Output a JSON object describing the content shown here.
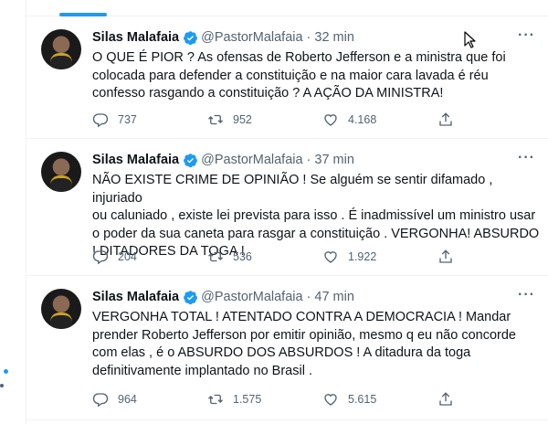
{
  "accent": "#1d9bf0",
  "tweets": [
    {
      "name": "Silas Malafaia",
      "handle": "@PastorMalafaia",
      "separator": "·",
      "time": "32 min",
      "more": "···",
      "text_lines": [
        "O QUE É PIOR ? As ofensas de Roberto Jefferson e a ministra que foi",
        "colocada para defender a constituição e na maior cara lavada é réu",
        "confesso rasgando a constituição ? A AÇÃO DA MINISTRA!"
      ],
      "replies": "737",
      "retweets": "952",
      "likes": "4.168"
    },
    {
      "name": "Silas Malafaia",
      "handle": "@PastorMalafaia",
      "separator": "·",
      "time": "37 min",
      "more": "···",
      "text_lines": [
        "NÃO EXISTE CRIME DE OPINIÃO ! Se alguém se sentir difamado , injuriado",
        "ou caluniado , existe lei prevista para isso . É inadmissível um ministro usar",
        "o poder da sua caneta para rasgar a constituição . VERGONHA! ABSURDO",
        "! DITADORES DA TOGA !"
      ],
      "replies": "204",
      "retweets": "536",
      "likes": "1.922"
    },
    {
      "name": "Silas Malafaia",
      "handle": "@PastorMalafaia",
      "separator": "·",
      "time": "47 min",
      "more": "···",
      "text_lines": [
        "VERGONHA TOTAL ! ATENTADO CONTRA A DEMOCRACIA ! Mandar",
        "prender Roberto Jefferson por emitir opinião, mesmo q eu não concorde",
        "com elas , é o ABSURDO DOS ABSURDOS ! A ditadura da toga",
        "definitivamente implantado no Brasil ."
      ],
      "replies": "964",
      "retweets": "1.575",
      "likes": "5.615"
    }
  ],
  "icons": [
    "verified-badge-icon",
    "reply-icon",
    "retweet-icon",
    "like-icon",
    "share-icon",
    "more-icon",
    "mouse-cursor-icon"
  ]
}
